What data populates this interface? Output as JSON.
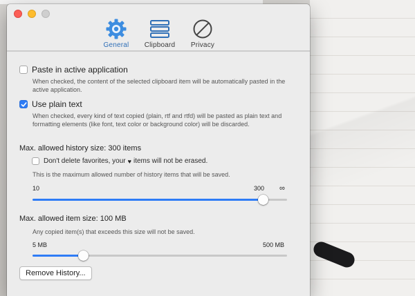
{
  "window": {
    "tabs": [
      {
        "label": "General",
        "icon": "gear-icon",
        "active": true
      },
      {
        "label": "Clipboard",
        "icon": "clipboard-lines-icon",
        "active": false
      },
      {
        "label": "Privacy",
        "icon": "prohibited-icon",
        "active": false
      }
    ]
  },
  "general": {
    "paste_in_active": {
      "label": "Paste in active application",
      "checked": false,
      "description": "When checked, the content of the selected clipboard item will be automatically pasted in the active application."
    },
    "plain_text": {
      "label": "Use plain text",
      "checked": true,
      "description": "When checked, every kind of text copied (plain, rtf and rtfd) will be pasted as plain text and formatting elements (like font, text color or background color) will be discarded."
    },
    "history": {
      "heading": "Max. allowed history size: 300 items",
      "favorites_prefix": "Don't delete favorites, your",
      "favorites_suffix": "items will not be erased.",
      "favorites_checked": false,
      "note": "This is the maximum allowed number of history items that will be saved.",
      "min_label": "10",
      "value_label": "300",
      "max_label": "∞",
      "fraction": 0.905
    },
    "item_size": {
      "heading": "Max. allowed item size: 100 MB",
      "note": "Any copied item(s) that exceeds this size will not be saved.",
      "min_label": "5 MB",
      "max_label": "500 MB",
      "fraction": 0.2
    },
    "remove_button": "Remove History..."
  },
  "colors": {
    "accent": "#2e7cf6",
    "tab_active": "#2f6fb7"
  }
}
